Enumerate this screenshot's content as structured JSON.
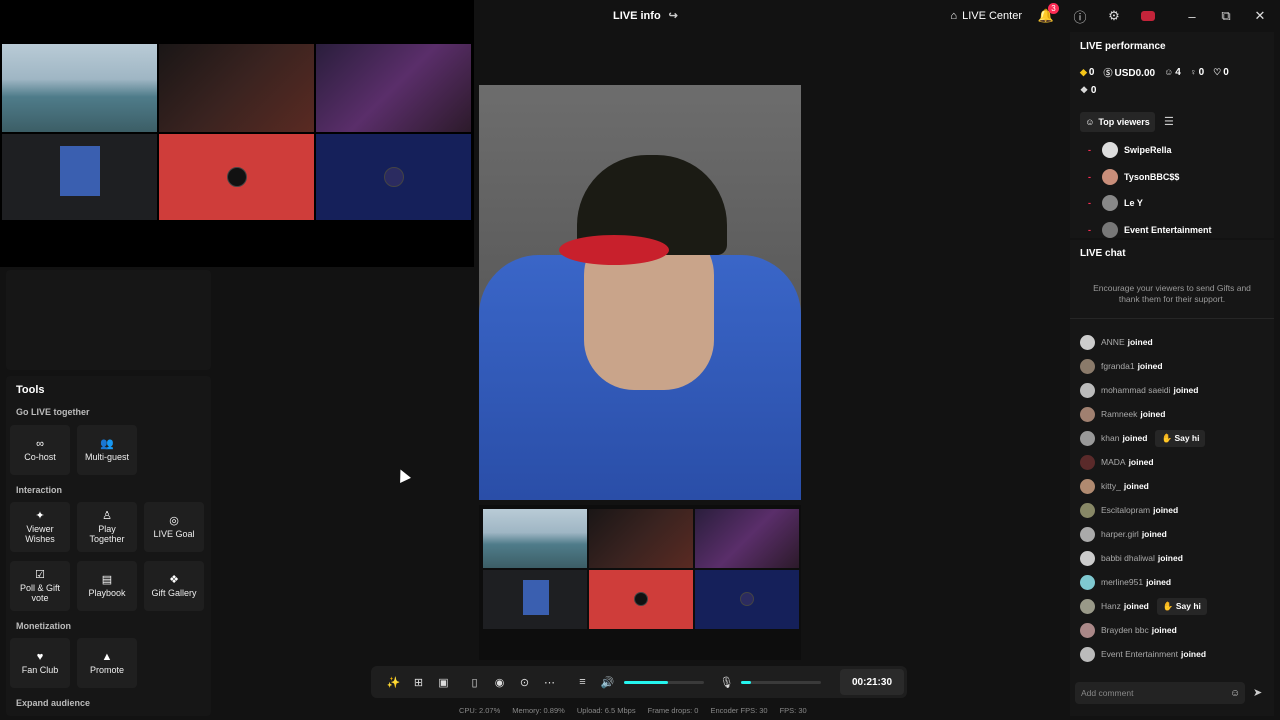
{
  "titlebar": {
    "title": "LIVE info",
    "live_center_label": "LIVE Center",
    "notification_count": "3"
  },
  "performance": {
    "title": "LIVE performance",
    "diamonds": "0",
    "earnings": "USD0.00",
    "viewers": "4",
    "new_followers": "0",
    "likes": "0",
    "gifts": "0",
    "top_viewers_tab": "Top viewers",
    "top_viewers": [
      {
        "rank": "-",
        "name": "SwipeRella"
      },
      {
        "rank": "-",
        "name": "TysonBBC$$"
      },
      {
        "rank": "-",
        "name": "Le Y"
      },
      {
        "rank": "-",
        "name": "Event Entertainment"
      }
    ]
  },
  "chat": {
    "title": "LIVE chat",
    "hint": "Encourage your viewers to send Gifts and thank them for their support.",
    "messages": [
      {
        "user": "ANNE",
        "action": "joined",
        "say_hi": ""
      },
      {
        "user": "fgranda1",
        "action": "joined",
        "say_hi": ""
      },
      {
        "user": "mohammad saeidi",
        "action": "joined",
        "say_hi": ""
      },
      {
        "user": "Ramneek",
        "action": "joined",
        "say_hi": ""
      },
      {
        "user": "khan",
        "action": "joined",
        "say_hi": "Say hi"
      },
      {
        "user": "MADA",
        "action": "joined",
        "say_hi": ""
      },
      {
        "user": "kitty_",
        "action": "joined",
        "say_hi": ""
      },
      {
        "user": "Escitalopram",
        "action": "joined",
        "say_hi": ""
      },
      {
        "user": "harper.girl",
        "action": "joined",
        "say_hi": ""
      },
      {
        "user": "babbi dhaliwal",
        "action": "joined",
        "say_hi": ""
      },
      {
        "user": "merline951",
        "action": "joined",
        "say_hi": ""
      },
      {
        "user": "Hanz",
        "action": "joined",
        "say_hi": "Say hi"
      },
      {
        "user": "Brayden bbc",
        "action": "joined",
        "say_hi": ""
      },
      {
        "user": "Event Entertainment",
        "action": "joined",
        "say_hi": ""
      }
    ],
    "input_placeholder": "Add comment"
  },
  "tools": {
    "title": "Tools",
    "sections": {
      "go_live_together": "Go LIVE together",
      "interaction": "Interaction",
      "monetization": "Monetization",
      "expand_audience": "Expand audience"
    },
    "co_host": "Co-host",
    "multi_guest": "Multi-guest",
    "viewer_wishes": "Viewer Wishes",
    "play_together": "Play Together",
    "live_goal": "LIVE Goal",
    "poll_gift_vote": "Poll & Gift vote",
    "playbook": "Playbook",
    "gift_gallery": "Gift Gallery",
    "fan_club": "Fan Club",
    "promote": "Promote"
  },
  "controls": {
    "timer": "00:21:30",
    "volume_level": 0.55,
    "mic_level": 0.12
  },
  "stats": {
    "cpu": "CPU: 2.07%",
    "memory": "Memory: 0.89%",
    "upload": "Upload: 6.5 Mbps",
    "frame_drops": "Frame drops: 0",
    "encoder_fps": "Encoder FPS: 30",
    "fps": "FPS: 30"
  },
  "colors": {
    "accent": "#fe2c55",
    "cyan": "#25f4ee"
  }
}
